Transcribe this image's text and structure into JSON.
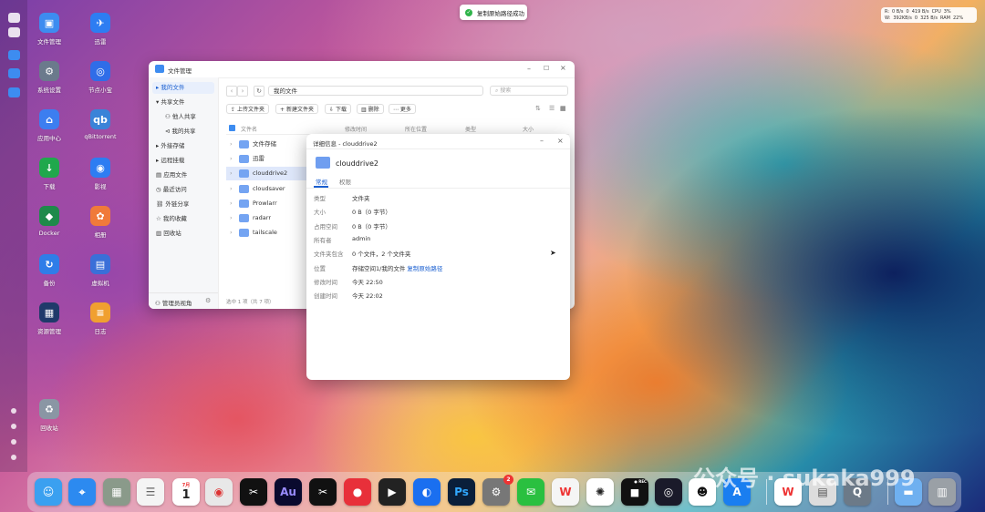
{
  "toast": {
    "text": "复制原始路径成功"
  },
  "net": {
    "row1": [
      "R:",
      "0 B/s",
      "0",
      "419 B/s",
      "CPU",
      "3%"
    ],
    "row2": [
      "W:",
      "392KB/s",
      "0",
      "325 B/s",
      "RAM",
      "22%"
    ]
  },
  "desktop": {
    "icons": [
      {
        "label": "文件管理",
        "glyph": "▣",
        "color": "#3d8cf0"
      },
      {
        "label": "迅雷",
        "glyph": "✈",
        "color": "#2d7df2"
      },
      {
        "label": "系统设置",
        "glyph": "⚙",
        "color": "#6b7a8c"
      },
      {
        "label": "节点小宝",
        "glyph": "◎",
        "color": "#2f6de8"
      },
      {
        "label": "应用中心",
        "glyph": "⌂",
        "color": "#3c7ef0"
      },
      {
        "label": "qBittorrent",
        "glyph": "qb",
        "color": "#3a83d8"
      },
      {
        "label": "下载",
        "glyph": "↓",
        "color": "#20a84c"
      },
      {
        "label": "影视",
        "glyph": "◉",
        "color": "#2d7df2"
      },
      {
        "label": "Docker",
        "glyph": "◆",
        "color": "#1f8a4a"
      },
      {
        "label": "相册",
        "glyph": "✿",
        "color": "#f07a3a"
      },
      {
        "label": "备份",
        "glyph": "↻",
        "color": "#2f7de8"
      },
      {
        "label": "虚拟机",
        "glyph": "▤",
        "color": "#3a6fd8"
      },
      {
        "label": "资源管理",
        "glyph": "▦",
        "color": "#1f3a6a"
      },
      {
        "label": "日志",
        "glyph": "≡",
        "color": "#f0a030"
      },
      {
        "label": "回收站",
        "glyph": "♻",
        "color": "#8a96a4"
      }
    ]
  },
  "fm": {
    "title": "文件管理",
    "path": "我的文件",
    "search_placeholder": "搜索",
    "sidebar": [
      {
        "label": "我的文件",
        "icon": "▸"
      },
      {
        "label": "共享文件",
        "icon": "▾"
      },
      {
        "label": "他人共享",
        "icon": "⚇"
      },
      {
        "label": "我的共享",
        "icon": "⊲"
      },
      {
        "label": "外接存储",
        "icon": "▸"
      },
      {
        "label": "远程挂载",
        "icon": "▸"
      },
      {
        "label": "应用文件",
        "icon": "▤"
      },
      {
        "label": "最近访问",
        "icon": "◷"
      },
      {
        "label": "外链分享",
        "icon": "⛓"
      },
      {
        "label": "我的收藏",
        "icon": "☆"
      },
      {
        "label": "回收站",
        "icon": "▥"
      }
    ],
    "admin": "管理员视角",
    "toolbar": {
      "upload": "上传文件夹",
      "newfolder": "新建文件夹",
      "download": "下载",
      "delete": "删除",
      "more": "更多"
    },
    "columns": {
      "name": "文件名",
      "mtime": "修改时间",
      "location": "所在位置",
      "type": "类型",
      "size": "大小"
    },
    "files": [
      "文件存储",
      "迅雷",
      "clouddrive2",
      "cloudsaver",
      "Prowlarr",
      "radarr",
      "tailscale"
    ],
    "status": "选中 1 项（共 7 项）"
  },
  "details": {
    "title": "详细信息 - clouddrive2",
    "name": "clouddrive2",
    "tabs": [
      "常规",
      "权限"
    ],
    "rows": [
      {
        "k": "类型",
        "v": "文件夹"
      },
      {
        "k": "大小",
        "v": "0 B（0 字节）"
      },
      {
        "k": "占用空间",
        "v": "0 B（0 字节）"
      },
      {
        "k": "所有者",
        "v": "admin"
      },
      {
        "k": "文件夹包含",
        "v": "0 个文件，2 个文件夹"
      },
      {
        "k": "位置",
        "v": "存储空间1/我的文件",
        "link": "复制原始路径"
      },
      {
        "k": "修改时间",
        "v": "今天 22:50"
      },
      {
        "k": "创建时间",
        "v": "今天 22:02"
      }
    ]
  },
  "dock": {
    "calendar_month": "7月",
    "calendar_day": "1",
    "badge": "2",
    "au": "Au",
    "ps": "Ps",
    "rec": "● REC"
  },
  "watermark": "公众号 · sukaka999"
}
